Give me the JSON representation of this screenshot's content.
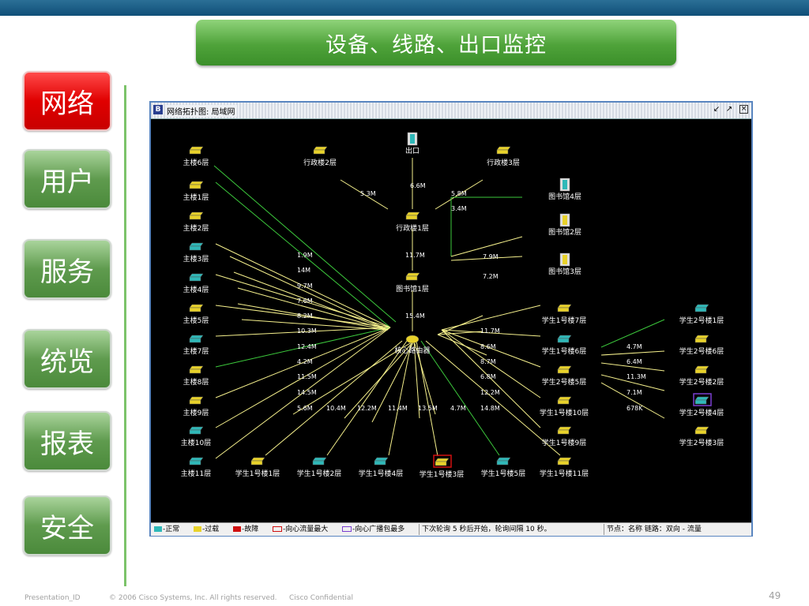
{
  "header": {
    "title": "设备、线路、出口监控"
  },
  "nav": [
    {
      "label": "网络",
      "active": true
    },
    {
      "label": "用户",
      "active": false
    },
    {
      "label": "服务",
      "active": false
    },
    {
      "label": "统览",
      "active": false
    },
    {
      "label": "报表",
      "active": false
    },
    {
      "label": "安全",
      "active": false
    }
  ],
  "window": {
    "title": "网络拓扑图: 局域网",
    "controls": [
      "restore",
      "maximize",
      "close"
    ]
  },
  "colors": {
    "line_green": "#3cc83c",
    "line_yellow": "#f5f08c",
    "normal": "#2fb8b8",
    "overload": "#e8d22a",
    "fault": "#d01010"
  },
  "topology": {
    "nodes": [
      {
        "id": "n_exit",
        "label": "出口",
        "icon": "server-icon",
        "status": "normal"
      },
      {
        "id": "n_admin1",
        "label": "行政楼1层",
        "icon": "switch-icon",
        "status": "overload"
      },
      {
        "id": "n_lib1",
        "label": "图书馆1层",
        "icon": "switch-icon",
        "status": "overload"
      },
      {
        "id": "n_core",
        "label": "核心路由器",
        "icon": "router-icon",
        "status": "overload"
      },
      {
        "id": "n_admin2",
        "label": "行政楼2层",
        "icon": "switch-icon",
        "status": "overload"
      },
      {
        "id": "n_admin3",
        "label": "行政楼3层",
        "icon": "switch-icon",
        "status": "overload"
      },
      {
        "id": "n_lib4",
        "label": "图书馆4层",
        "icon": "server-icon",
        "status": "normal"
      },
      {
        "id": "n_lib2",
        "label": "图书馆2层",
        "icon": "server-icon",
        "status": "overload"
      },
      {
        "id": "n_lib3",
        "label": "图书馆3层",
        "icon": "server-icon",
        "status": "overload"
      },
      {
        "id": "m6",
        "label": "主楼6层",
        "icon": "switch-icon",
        "status": "overload"
      },
      {
        "id": "m1",
        "label": "主楼1层",
        "icon": "switch-icon",
        "status": "overload"
      },
      {
        "id": "m2",
        "label": "主楼2层",
        "icon": "switch-icon",
        "status": "overload"
      },
      {
        "id": "m3",
        "label": "主楼3层",
        "icon": "switch-icon",
        "status": "normal"
      },
      {
        "id": "m4",
        "label": "主楼4层",
        "icon": "switch-icon",
        "status": "normal"
      },
      {
        "id": "m5",
        "label": "主楼5层",
        "icon": "switch-icon",
        "status": "overload"
      },
      {
        "id": "m7",
        "label": "主楼7层",
        "icon": "switch-icon",
        "status": "normal"
      },
      {
        "id": "m8",
        "label": "主楼8层",
        "icon": "switch-icon",
        "status": "overload"
      },
      {
        "id": "m9",
        "label": "主楼9层",
        "icon": "switch-icon",
        "status": "overload"
      },
      {
        "id": "m10",
        "label": "主楼10层",
        "icon": "switch-icon",
        "status": "normal"
      },
      {
        "id": "m11",
        "label": "主楼11层",
        "icon": "switch-icon",
        "status": "normal"
      },
      {
        "id": "s1_1",
        "label": "学生1号楼1层",
        "icon": "switch-icon",
        "status": "overload"
      },
      {
        "id": "s1_2",
        "label": "学生1号楼2层",
        "icon": "switch-icon",
        "status": "normal"
      },
      {
        "id": "s1_4",
        "label": "学生1号楼4层",
        "icon": "switch-icon",
        "status": "normal"
      },
      {
        "id": "s1_3",
        "label": "学生1号楼3层",
        "icon": "switch-icon",
        "status": "overload",
        "highlight": "red"
      },
      {
        "id": "s1_5",
        "label": "学生1号楼5层",
        "icon": "switch-icon",
        "status": "normal"
      },
      {
        "id": "s1_11",
        "label": "学生1号楼11层",
        "icon": "switch-icon",
        "status": "overload"
      },
      {
        "id": "s1_7",
        "label": "学生1号楼7层",
        "icon": "switch-icon",
        "status": "overload"
      },
      {
        "id": "s1_6",
        "label": "学生1号楼6层",
        "icon": "switch-icon",
        "status": "normal"
      },
      {
        "id": "s2_5",
        "label": "学生2号楼5层",
        "icon": "switch-icon",
        "status": "overload"
      },
      {
        "id": "s1_10",
        "label": "学生1号楼10层",
        "icon": "switch-icon",
        "status": "overload"
      },
      {
        "id": "s1_9",
        "label": "学生1号楼9层",
        "icon": "switch-icon",
        "status": "overload"
      },
      {
        "id": "s2_1",
        "label": "学生2号楼1层",
        "icon": "switch-icon",
        "status": "normal"
      },
      {
        "id": "s2_6",
        "label": "学生2号楼6层",
        "icon": "switch-icon",
        "status": "overload"
      },
      {
        "id": "s2_2",
        "label": "学生2号楼2层",
        "icon": "switch-icon",
        "status": "overload"
      },
      {
        "id": "s2_4",
        "label": "学生2号楼4层",
        "icon": "switch-icon",
        "status": "normal",
        "highlight": "purple"
      },
      {
        "id": "s2_3",
        "label": "学生2号楼3层",
        "icon": "switch-icon",
        "status": "overload"
      }
    ],
    "link_labels": [
      "6.6M",
      "5.3M",
      "5.8M",
      "3.4M",
      "11.7M",
      "7.9M",
      "7.2M",
      "15.4M",
      "1.9M",
      "14M",
      "9.7M",
      "7.6M",
      "8.2M",
      "10.3M",
      "12.4M",
      "4.2M",
      "11.5M",
      "14.5M",
      "5.6M",
      "10.4M",
      "12.2M",
      "11.4M",
      "13.5M",
      "4.7M",
      "14.8M",
      "11.7M",
      "8.6M",
      "8.7M",
      "6.8M",
      "12.2M",
      "4.7M",
      "6.4M",
      "11.3M",
      "7.1M",
      "678K"
    ]
  },
  "statusbar": {
    "legend": [
      {
        "label": "-正常",
        "type": "normal"
      },
      {
        "label": "-过载",
        "type": "overload"
      },
      {
        "label": "-故障",
        "type": "fault"
      },
      {
        "label": "-向心流量最大",
        "type": "box-red"
      },
      {
        "label": "-向心广播包最多",
        "type": "box-purple"
      }
    ],
    "poll_text": "下次轮询 5 秒后开始，轮询间隔 10 秒。",
    "legend_text": "节点：名称   链路：双向 - 流量"
  },
  "footer": {
    "presentation_id": "Presentation_ID",
    "copyright": "© 2006 Cisco Systems, Inc. All rights reserved.",
    "confidential": "Cisco Confidential",
    "page": "49"
  }
}
